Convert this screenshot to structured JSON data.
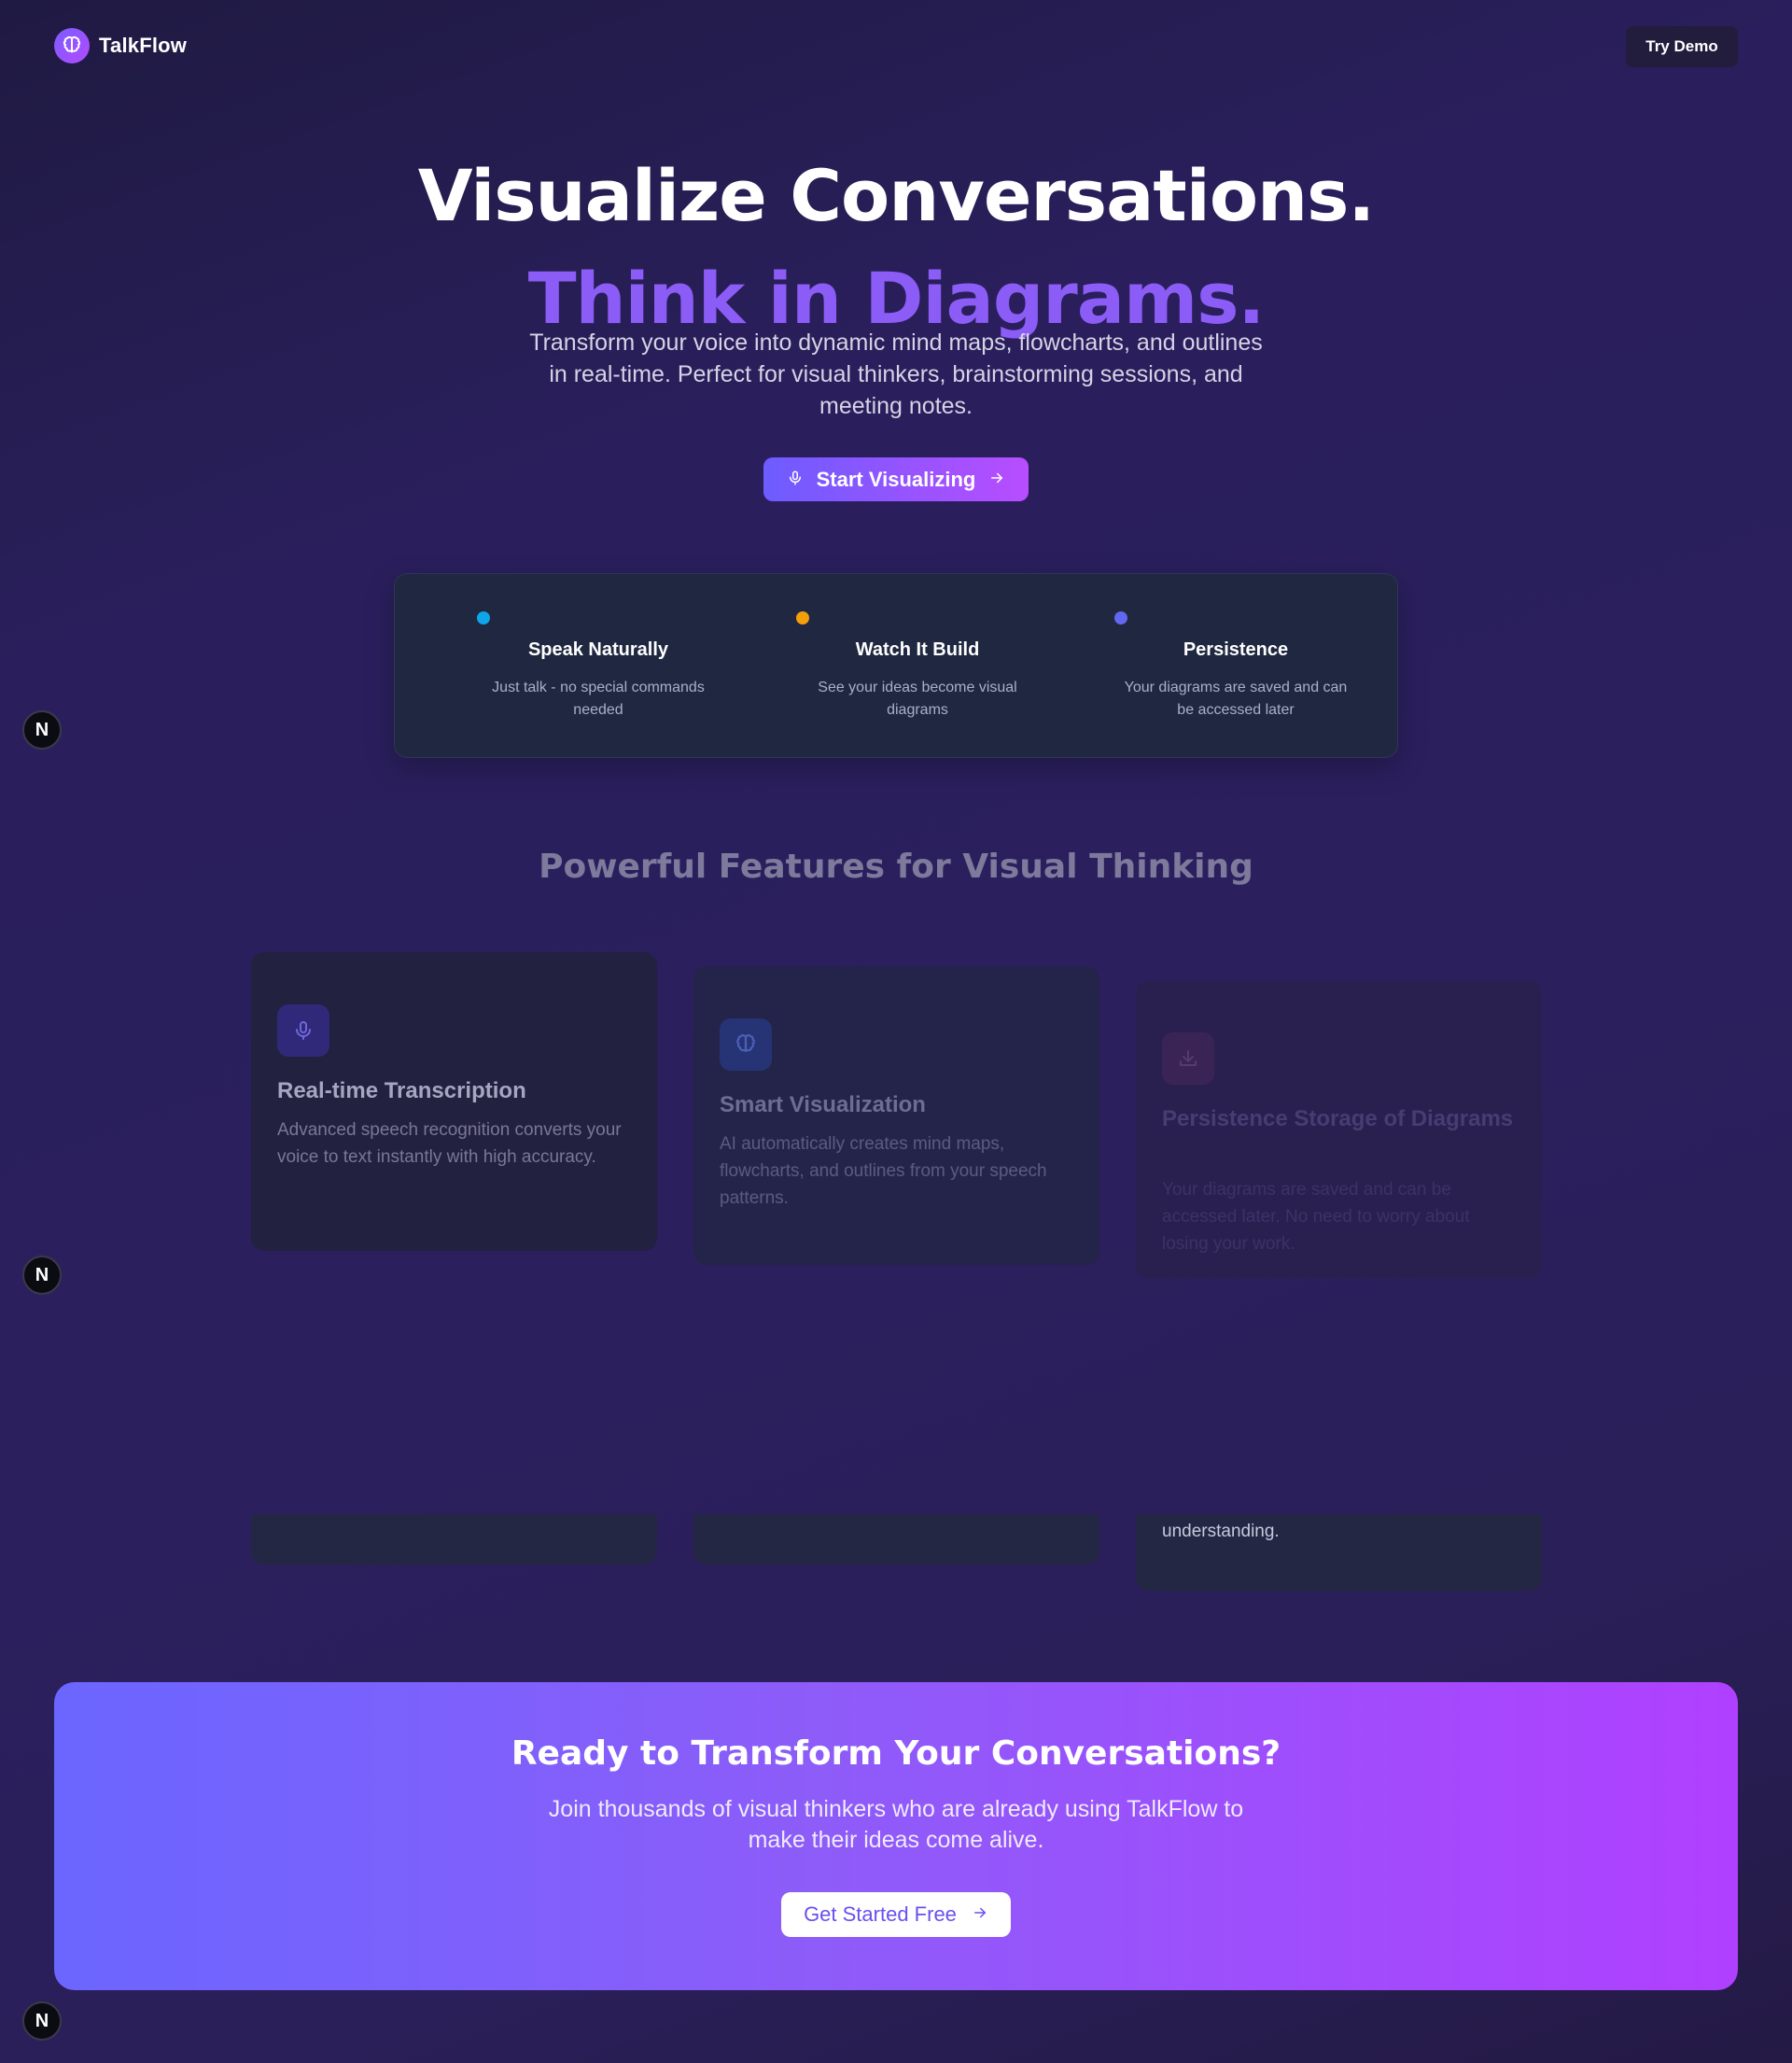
{
  "header": {
    "brand": "TalkFlow",
    "try_demo": "Try Demo"
  },
  "hero": {
    "title_line1": "Visualize Conversations.",
    "title_line2": "Think in Diagrams.",
    "subtitle": "Transform your voice into dynamic mind maps, flowcharts, and outlines in real-time. Perfect for visual thinkers, brainstorming sessions, and meeting notes.",
    "cta": "Start Visualizing"
  },
  "quick_features": [
    {
      "title": "Speak Naturally",
      "desc": "Just talk - no special commands needed",
      "color": "#0ea5e9"
    },
    {
      "title": "Watch It Build",
      "desc": "See your ideas become visual diagrams",
      "color": "#f59e0b"
    },
    {
      "title": "Persistence",
      "desc": "Your diagrams are saved and can be accessed later",
      "color": "#6366f1"
    }
  ],
  "features": {
    "title": "Powerful Features for Visual Thinking",
    "cards": [
      {
        "title": "Real-time Transcription",
        "desc": "Advanced speech recognition converts your voice to text instantly with high accuracy.",
        "icon": "microphone-icon"
      },
      {
        "title": "Smart Visualization",
        "desc": "AI automatically creates mind maps, flowcharts, and outlines from your speech patterns.",
        "icon": "brain-icon"
      },
      {
        "title": "Persistence Storage of Diagrams",
        "desc": "Your diagrams are saved and can be accessed later. No need to worry about losing your work.",
        "icon": "download-icon"
      }
    ],
    "lower_card_text": "understanding."
  },
  "banner": {
    "title": "Ready to Transform Your Conversations?",
    "subtitle": "Join thousands of visual thinkers who are already using TalkFlow to make their ideas come alive.",
    "cta": "Get Started Free"
  },
  "badges": {
    "letter": "N"
  }
}
